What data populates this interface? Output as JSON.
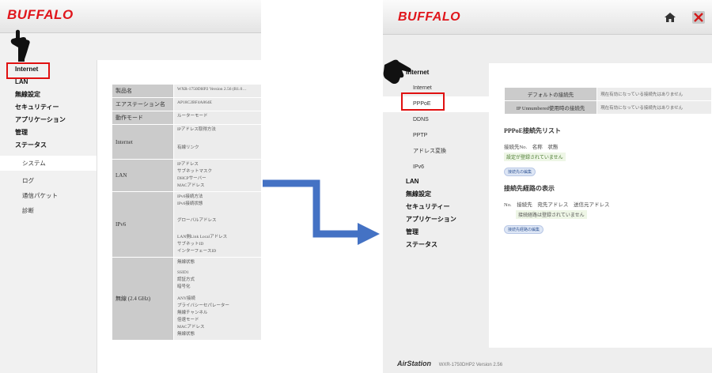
{
  "left": {
    "logo": "BUFFALO",
    "nav_top": [
      {
        "label": "Internet"
      },
      {
        "label": "LAN"
      },
      {
        "label": "無線設定"
      },
      {
        "label": "セキュリティー"
      },
      {
        "label": "アプリケーション"
      },
      {
        "label": "管理"
      },
      {
        "label": "ステータス"
      }
    ],
    "nav_sub": [
      {
        "label": "システム"
      },
      {
        "label": "ログ"
      },
      {
        "label": "通信パケット"
      },
      {
        "label": "診断"
      }
    ],
    "table": {
      "product_name_key": "製品名",
      "product_name_val": "WXR-1750DHP2  Version 2.56 (R1.0…",
      "airstation_key": "エアステーション名",
      "airstation_val": "AP18C2BF4A864E",
      "mode_key": "動作モード",
      "mode_val": "ルーターモード",
      "internet_key": "Internet",
      "internet_vals": [
        "IPアドレス取得方法",
        "有線リンク"
      ],
      "lan_key": "LAN",
      "lan_vals": [
        "IPアドレス",
        "サブネットマスク",
        "DHCPサーバー",
        "MACアドレス"
      ],
      "ipv6_key": "IPv6",
      "ipv6_vals": [
        "IPv6接続方法",
        "IPv6接続状態",
        "グローバルアドレス",
        "LAN側Link Localアドレス",
        "サブネットID",
        "インターフェースID"
      ],
      "wireless_key": "無線 (2.4 GHz)",
      "wireless_vals": [
        "無線状態",
        "SSID1",
        "認証方式",
        "暗号化",
        "ANY接続",
        "プライバシーセパレーター",
        "無線チャンネル",
        "倍速モード",
        "MACアドレス",
        "無線状態"
      ]
    }
  },
  "right": {
    "logo": "BUFFALO",
    "nav_top": [
      {
        "label": "Internet"
      }
    ],
    "nav_internet_sub": [
      {
        "label": "Internet"
      },
      {
        "label": "PPPoE"
      },
      {
        "label": "DDNS"
      },
      {
        "label": "PPTP"
      },
      {
        "label": "アドレス変換"
      },
      {
        "label": "IPv6"
      }
    ],
    "nav_rest": [
      {
        "label": "LAN"
      },
      {
        "label": "無線設定"
      },
      {
        "label": "セキュリティー"
      },
      {
        "label": "アプリケーション"
      },
      {
        "label": "管理"
      },
      {
        "label": "ステータス"
      }
    ],
    "default_conn_key": "デフォルトの接続先",
    "default_conn_val": "現在有効になっている接続先はありません",
    "unnumbered_key": "IP Unnumbered使用時の接続先",
    "unnumbered_val": "現在有効になっている接続先はありません",
    "pppoe_list_title": "PPPoE接続先リスト",
    "pppoe_list_cols": [
      "接続先No.",
      "名称",
      "状態"
    ],
    "pppoe_list_empty": "設定が登録されていません",
    "pppoe_edit_button": "接続先の編集",
    "route_title": "接続先経路の表示",
    "route_cols": [
      "No.",
      "接続先",
      "宛先アドレス",
      "送信元アドレス"
    ],
    "route_empty": "接続経路は登録されていません",
    "route_edit_button": "接続先経路の編集",
    "footer_brand": "AirStation",
    "footer_model": "WXR-1750DHP2  Version 2.56"
  },
  "colors": {
    "brand_red": "#e0161c",
    "highlight": "#e01010",
    "arrow": "#4472c4"
  }
}
